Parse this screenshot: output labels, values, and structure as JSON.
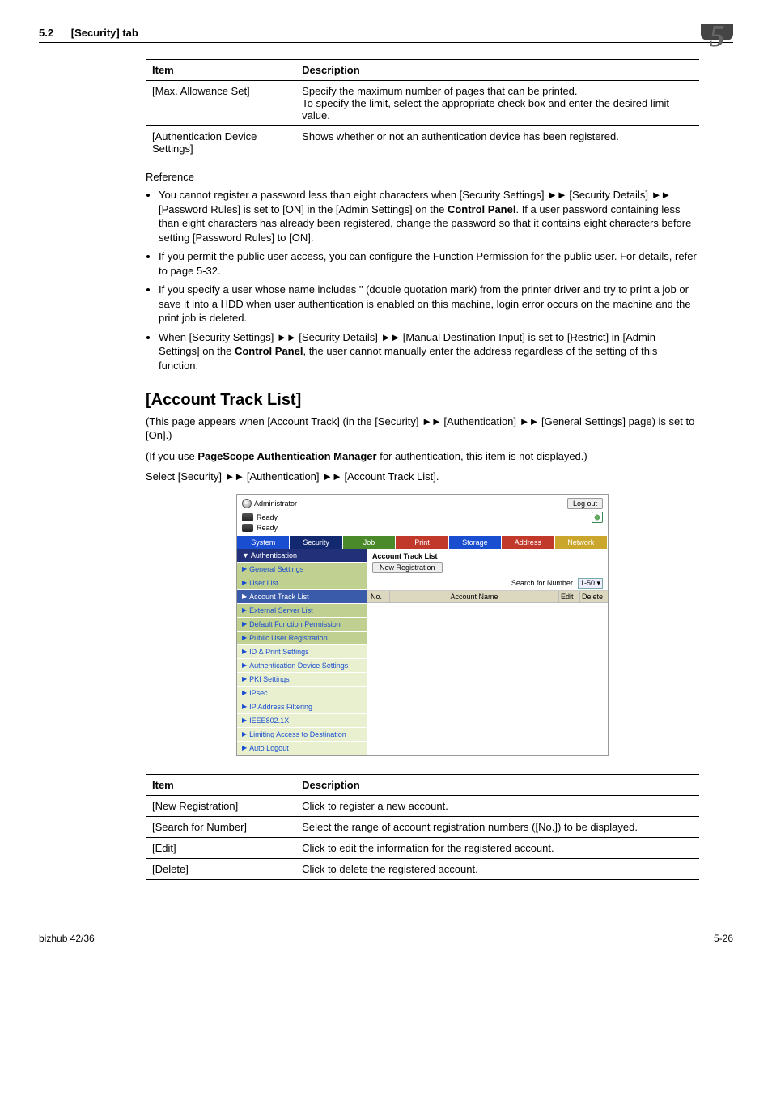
{
  "header": {
    "section": "5.2",
    "tab": "[Security] tab",
    "chapter": "5"
  },
  "table1": {
    "head_item": "Item",
    "head_desc": "Description",
    "rows": [
      {
        "item": "[Max. Allowance Set]",
        "desc": "Specify the maximum number of pages that can be printed.\nTo specify the limit, select the appropriate check box and enter the desired limit value."
      },
      {
        "item": "[Authentication Device Settings]",
        "desc": "Shows whether or not an authentication device has been registered."
      }
    ]
  },
  "reference_label": "Reference",
  "ref_bullets": {
    "b1a": "You cannot register a password less than eight characters when [Security Settings] ",
    "b1b": " [Security Details] ",
    "b1c": " [Password Rules] is set to [ON] in the [Admin Settings] on the ",
    "b1_bold": "Control Panel",
    "b1d": ". If a user password containing less than eight characters has already been registered, change the password so that it contains eight characters before setting [Password Rules] to [ON].",
    "b2": "If you permit the public user access, you can configure the Function Permission for the public user. For details, refer to page 5-32.",
    "b3": "If you specify a user whose name includes \" (double quotation mark) from the printer driver and try to print a job or save it into a HDD when user authentication is enabled on this machine, login error occurs on the machine and the print job is deleted.",
    "b4a": "When [Security Settings] ",
    "b4b": " [Security Details] ",
    "b4c": " [Manual Destination Input] is set to [Restrict] in [Admin Settings] on the ",
    "b4_bold": "Control Panel",
    "b4d": ", the user cannot manually enter the address regardless of the setting of this function."
  },
  "arrows": "►►",
  "section_title": "[Account Track List]",
  "intro1a": "(This page appears when [Account Track] (in the [Security] ",
  "intro1b": " [Authentication] ",
  "intro1c": " [General Settings] page) is set to [On].)",
  "intro2a": "(If you use ",
  "intro2_bold": "PageScope Authentication Manager",
  "intro2b": " for authentication, this item is not displayed.)",
  "intro3a": "Select [Security] ",
  "intro3b": " [Authentication] ",
  "intro3c": " [Account Track List].",
  "shot": {
    "admin_label": "Administrator",
    "logout": "Log out",
    "ready": "Ready",
    "tabs": {
      "system": "System",
      "security": "Security",
      "job": "Job",
      "print": "Print",
      "storage": "Storage",
      "address": "Address",
      "network": "Network"
    },
    "sidebar": {
      "auth": "▼ Authentication",
      "items": [
        "General Settings",
        "User List",
        "Account Track List",
        "External Server List",
        "Default Function Permission",
        "Public User Registration",
        "ID & Print Settings",
        "Authentication Device Settings",
        "PKI Settings",
        "IPsec",
        "IP Address Filtering",
        "IEEE802.1X",
        "Limiting Access to Destination",
        "Auto Logout"
      ]
    },
    "main": {
      "title": "Account Track List",
      "new_reg": "New Registration",
      "search_label": "Search for Number",
      "search_value": "1-50",
      "col_no": "No.",
      "col_name": "Account Name",
      "col_edit": "Edit",
      "col_delete": "Delete"
    }
  },
  "table2": {
    "head_item": "Item",
    "head_desc": "Description",
    "rows": [
      {
        "item": "[New Registration]",
        "desc": "Click to register a new account."
      },
      {
        "item": "[Search for Number]",
        "desc": "Select the range of account registration numbers ([No.]) to be displayed."
      },
      {
        "item": "[Edit]",
        "desc": "Click to edit the information for the registered account."
      },
      {
        "item": "[Delete]",
        "desc": "Click to delete the registered account."
      }
    ]
  },
  "footer": {
    "model": "bizhub 42/36",
    "page": "5-26"
  }
}
